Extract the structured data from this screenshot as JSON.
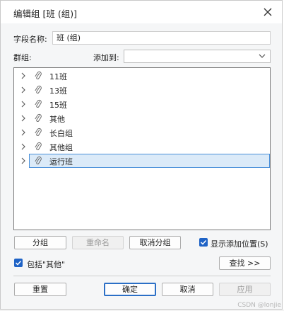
{
  "window": {
    "title": "编辑组 [班 (组)]"
  },
  "field": {
    "label": "字段名称:",
    "value": "班 (组)"
  },
  "groups_label": "群组:",
  "add_to": {
    "label": "添加到:",
    "value": ""
  },
  "groups": [
    {
      "label": "11班",
      "selected": false
    },
    {
      "label": "13班",
      "selected": false
    },
    {
      "label": "15班",
      "selected": false
    },
    {
      "label": "其他",
      "selected": false
    },
    {
      "label": "长白组",
      "selected": false
    },
    {
      "label": "其他组",
      "selected": false
    },
    {
      "label": "运行班",
      "selected": true
    }
  ],
  "actions": {
    "group": "分组",
    "rename": "重命名",
    "ungroup": "取消分组",
    "show_add_position": "显示添加位置(S)",
    "include_other": "包括\"其他\"",
    "find": "查找 >>"
  },
  "footer": {
    "reset": "重置",
    "ok": "确定",
    "cancel": "取消",
    "apply": "应用"
  },
  "watermark": "CSDN @lonjie",
  "colors": {
    "accent": "#1f63c6",
    "selection": "#dbeaf8",
    "selection_border": "#4a90d9"
  }
}
